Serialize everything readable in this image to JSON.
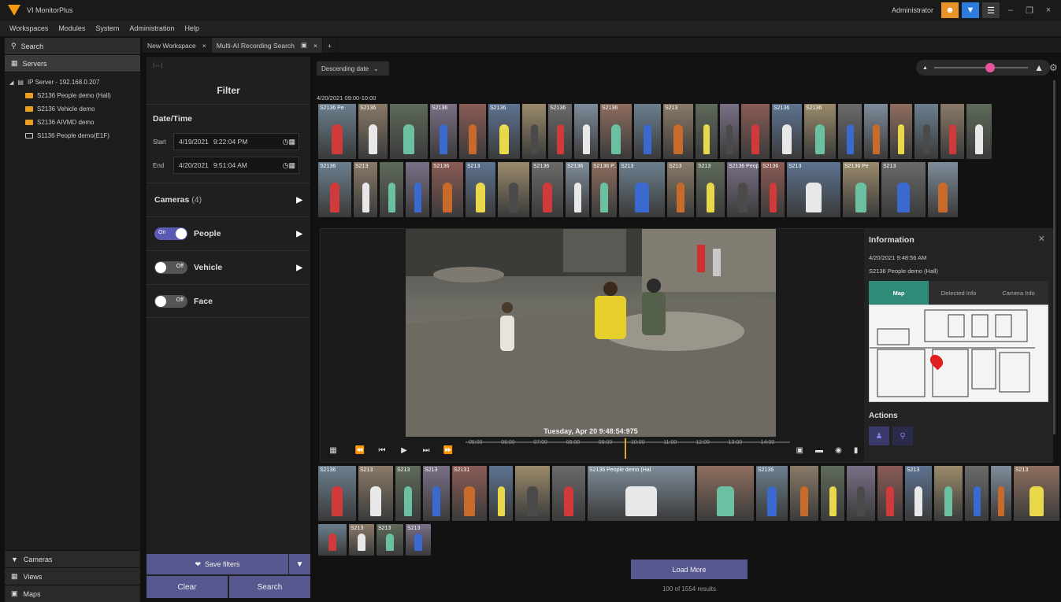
{
  "app": {
    "title": "VI MonitorPlus",
    "user": "Administrator"
  },
  "menu": [
    "Workspaces",
    "Modules",
    "System",
    "Administration",
    "Help"
  ],
  "nav": {
    "search": "Search",
    "servers": "Servers",
    "server_name": "IP Server - 192.168.0.207",
    "cameras_tree": [
      {
        "label": "S2136 People demo (Hall)",
        "icon": "camera-icon-orange"
      },
      {
        "label": "S2136 Vehicle demo",
        "icon": "camera-icon-orange"
      },
      {
        "label": "S2136 AIVMD demo",
        "icon": "camera-icon-orange"
      },
      {
        "label": "S1136 People demo(E1F)",
        "icon": "camera-icon-white"
      }
    ],
    "bottom": [
      "Cameras",
      "Views",
      "Maps"
    ]
  },
  "tabs": [
    {
      "label": "New Workspace"
    },
    {
      "label": "Multi-AI Recording Search"
    }
  ],
  "filter": {
    "title": "Filter",
    "datetime_title": "Date/Time",
    "start_label": "Start",
    "start_date": "4/19/2021",
    "start_time": "9:22:04 PM",
    "end_label": "End",
    "end_date": "4/20/2021",
    "end_time": "9:51:04 AM",
    "cameras_label": "Cameras",
    "cameras_count": "(4)",
    "people": {
      "label": "People",
      "state": "On"
    },
    "vehicle": {
      "label": "Vehicle",
      "state": "Off"
    },
    "face": {
      "label": "Face",
      "state": "Off"
    },
    "save_filters": "Save filters",
    "clear": "Clear",
    "search": "Search"
  },
  "results": {
    "sort": "Descending date",
    "zoom_fraction": 0.55,
    "group_label": "4/20/2021 09:00-10:00",
    "row1_captions": [
      "S2136 Pe",
      "S2136",
      "",
      "S2136",
      "",
      "S2136",
      "",
      "S2136",
      "",
      "S2136",
      "",
      "S213",
      "",
      "",
      "",
      "S2136",
      "S2136",
      "",
      "",
      "",
      "",
      "",
      ""
    ],
    "row2_captions": [
      "S2136",
      "S213",
      "",
      "",
      "S2136",
      "S213",
      "",
      "S2136",
      "S2136",
      "S2136 P...",
      "S213",
      "S213",
      "S213",
      "S2136 People",
      "S2136",
      "S213",
      "S2136 Pe",
      "S213",
      ""
    ],
    "row3_captions": [
      "S2136",
      "S213",
      "S213",
      "S213",
      "S2131",
      "",
      "",
      "",
      "S2136 People demo (Hal",
      "",
      "S2136",
      "",
      "",
      "",
      "",
      "S213",
      "",
      "",
      "",
      "S213",
      "S213"
    ],
    "row4_captions": [
      "",
      "S213",
      "S213",
      "S213"
    ],
    "load_more": "Load More",
    "count_text": "100 of 1554 results"
  },
  "player": {
    "timestamp": "Tuesday, Apr 20  9:48:54:975",
    "ticks": [
      "05:00",
      "06:00",
      "07:00",
      "08:00",
      "09:00",
      "10:00",
      "11:00",
      "12:00",
      "13:00",
      "14:00"
    ],
    "cursor_fraction": 0.49
  },
  "info": {
    "title": "Information",
    "datetime": "4/20/2021 9:48:56 AM",
    "camera": "S2136 People demo (Hall)",
    "tabs": [
      "Map",
      "Detected Info",
      "Camera Info"
    ],
    "actions_title": "Actions"
  },
  "colors": {
    "accent": "#585890",
    "tab_active": "#2f8a78",
    "pin": "#e02020",
    "toggle_on": "#5a5ab5"
  }
}
